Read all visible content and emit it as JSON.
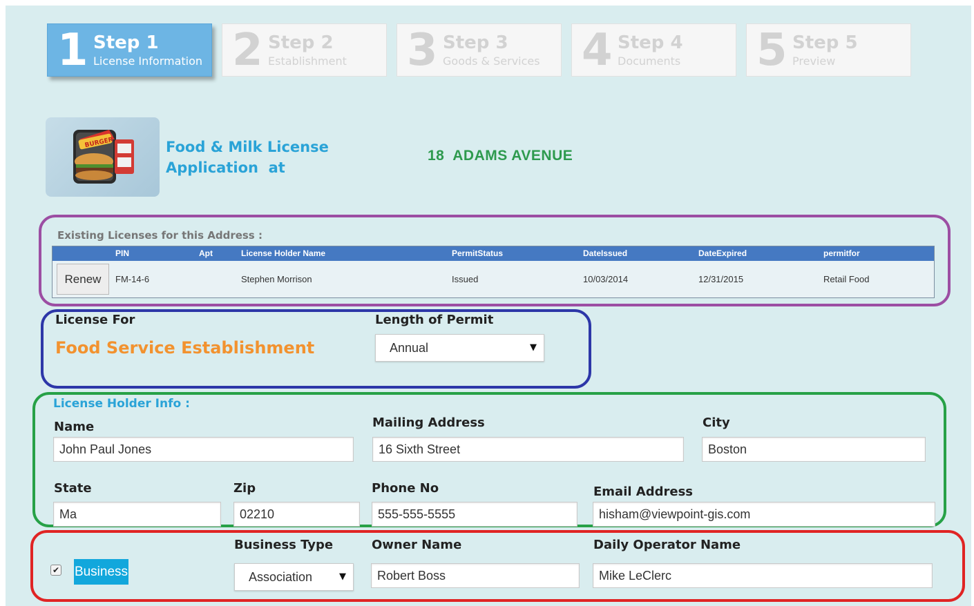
{
  "steps": [
    {
      "number": "1",
      "title": "Step 1",
      "subtitle": "License Information"
    },
    {
      "number": "2",
      "title": "Step 2",
      "subtitle": "Establishment"
    },
    {
      "number": "3",
      "title": "Step 3",
      "subtitle": "Goods & Services"
    },
    {
      "number": "4",
      "title": "Step 4",
      "subtitle": "Documents"
    },
    {
      "number": "5",
      "title": "Step 5",
      "subtitle": "Preview"
    }
  ],
  "header": {
    "logo_icon": "burger-stand-icon",
    "title_line1": "Food & Milk License",
    "title_line2": "Application  at",
    "address": "18  ADAMS AVENUE"
  },
  "existing": {
    "label": "Existing Licenses for this Address :",
    "columns": [
      "PIN",
      "Apt",
      "License Holder Name",
      "PermitStatus",
      "DateIssued",
      "DateExpired",
      "permitfor"
    ],
    "rows": [
      {
        "action": "Renew",
        "pin": "FM-14-6",
        "apt": "",
        "holder": "Stephen Morrison",
        "status": "Issued",
        "issued": "10/03/2014",
        "expired": "12/31/2015",
        "permitfor": "Retail Food"
      }
    ]
  },
  "license": {
    "for_label": "License For",
    "for_value": "Food Service Establishment",
    "length_label": "Length of Permit",
    "length_value": "Annual"
  },
  "holder": {
    "section_title": "License Holder Info :",
    "name_label": "Name",
    "name_value": "John Paul Jones",
    "mailing_label": "Mailing Address",
    "mailing_value": "16 Sixth Street",
    "city_label": "City",
    "city_value": "Boston",
    "state_label": "State",
    "state_value": "Ma",
    "zip_label": "Zip",
    "zip_value": "02210",
    "phone_label": "Phone No",
    "phone_value": "555-555-5555",
    "email_label": "Email Address",
    "email_value": "hisham@viewpoint-gis.com"
  },
  "business": {
    "checkbox_checked": true,
    "tag": "Business",
    "type_label": "Business Type",
    "type_value": "Association",
    "owner_label": "Owner Name",
    "owner_value": "Robert Boss",
    "operator_label": "Daily Operator Name",
    "operator_value": "Mike LeClerc"
  },
  "colors": {
    "background": "#d9edef",
    "active_step": "#6db5e4",
    "table_header": "#4579c2",
    "accent_blue": "#2aa3d7",
    "address_green": "#2e9a4e",
    "license_orange": "#f2922f",
    "frame_purple": "#9c4ea3",
    "frame_blue": "#2d37a8",
    "frame_green": "#27a147",
    "frame_red": "#e02424"
  }
}
